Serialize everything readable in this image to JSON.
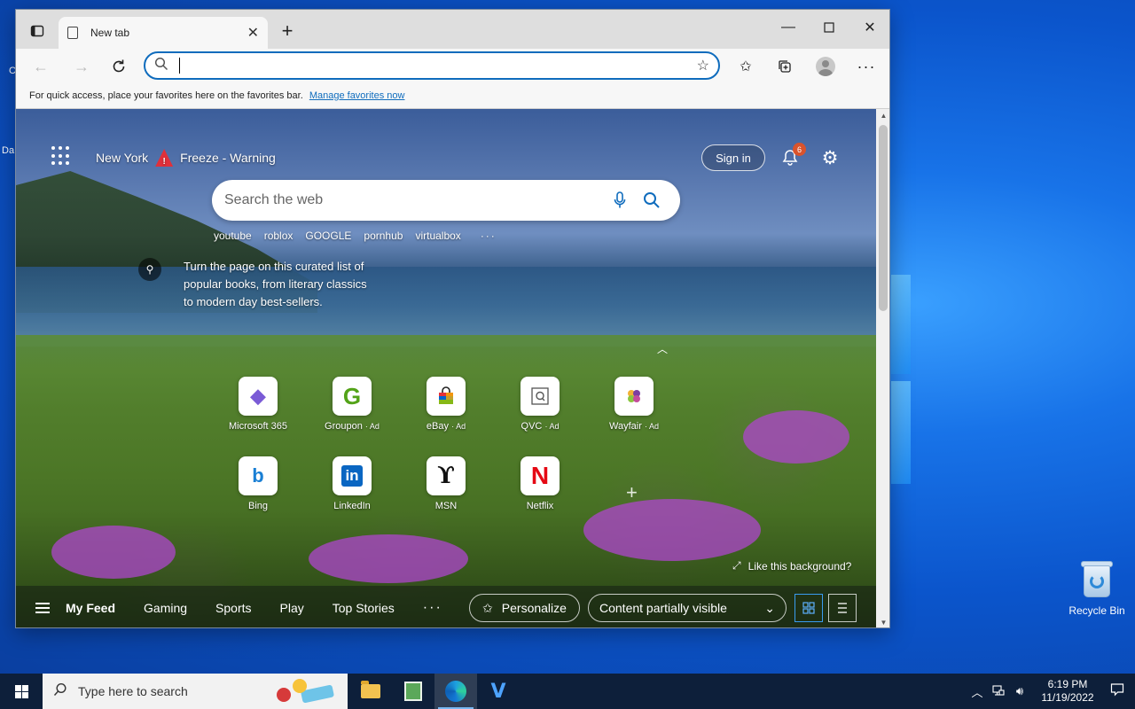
{
  "desktop": {
    "left_fragments": [
      "C",
      "Da"
    ],
    "recycle_bin_label": "Recycle Bin"
  },
  "browser": {
    "tab_title": "New tab",
    "address": {
      "value": "",
      "placeholder": ""
    },
    "favorites_bar": {
      "message": "For quick access, place your favorites here on the favorites bar.",
      "link": "Manage favorites now"
    }
  },
  "ntp": {
    "weather": {
      "city": "New York",
      "alert": "Freeze - Warning"
    },
    "sign_in": "Sign in",
    "notifications_count": "6",
    "search": {
      "placeholder": "Search the web"
    },
    "trending": [
      "youtube",
      "roblox",
      "GOOGLE",
      "pornhub",
      "virtualbox"
    ],
    "more_dots": "···",
    "promo": "Turn the page on this curated list of popular books, from literary classics to modern day best-sellers.",
    "tiles": [
      {
        "label": "Microsoft 365",
        "ad": "",
        "glyph": "◆",
        "color": "#7a5bd6"
      },
      {
        "label": "Groupon",
        "ad": "· Ad",
        "glyph": "G",
        "color": "#53a318"
      },
      {
        "label": "eBay",
        "ad": "· Ad",
        "glyph": "🛍",
        "color": "#e53238"
      },
      {
        "label": "QVC",
        "ad": "· Ad",
        "glyph": "Q",
        "color": "#555555"
      },
      {
        "label": "Wayfair",
        "ad": "· Ad",
        "glyph": "✿",
        "color": "#8b5fc9"
      },
      {
        "label": "Bing",
        "ad": "",
        "glyph": "b",
        "color": "#1a7fd4"
      },
      {
        "label": "LinkedIn",
        "ad": "",
        "glyph": "in",
        "color": "#0a66c2"
      },
      {
        "label": "MSN",
        "ad": "",
        "glyph": "ϒ",
        "color": "#111111"
      },
      {
        "label": "Netflix",
        "ad": "",
        "glyph": "N",
        "color": "#e50914"
      }
    ],
    "like_background": "Like this background?",
    "feed": {
      "items": [
        "My Feed",
        "Gaming",
        "Sports",
        "Play",
        "Top Stories"
      ],
      "more": "···",
      "personalize": "Personalize",
      "content_visibility": "Content partially visible"
    }
  },
  "taskbar": {
    "search_placeholder": "Type here to search",
    "apps": [
      "file-explorer",
      "spreadsheet-app",
      "microsoft-edge",
      "virtualbox"
    ],
    "active_app": "microsoft-edge",
    "time": "6:19 PM",
    "date": "11/19/2022"
  }
}
